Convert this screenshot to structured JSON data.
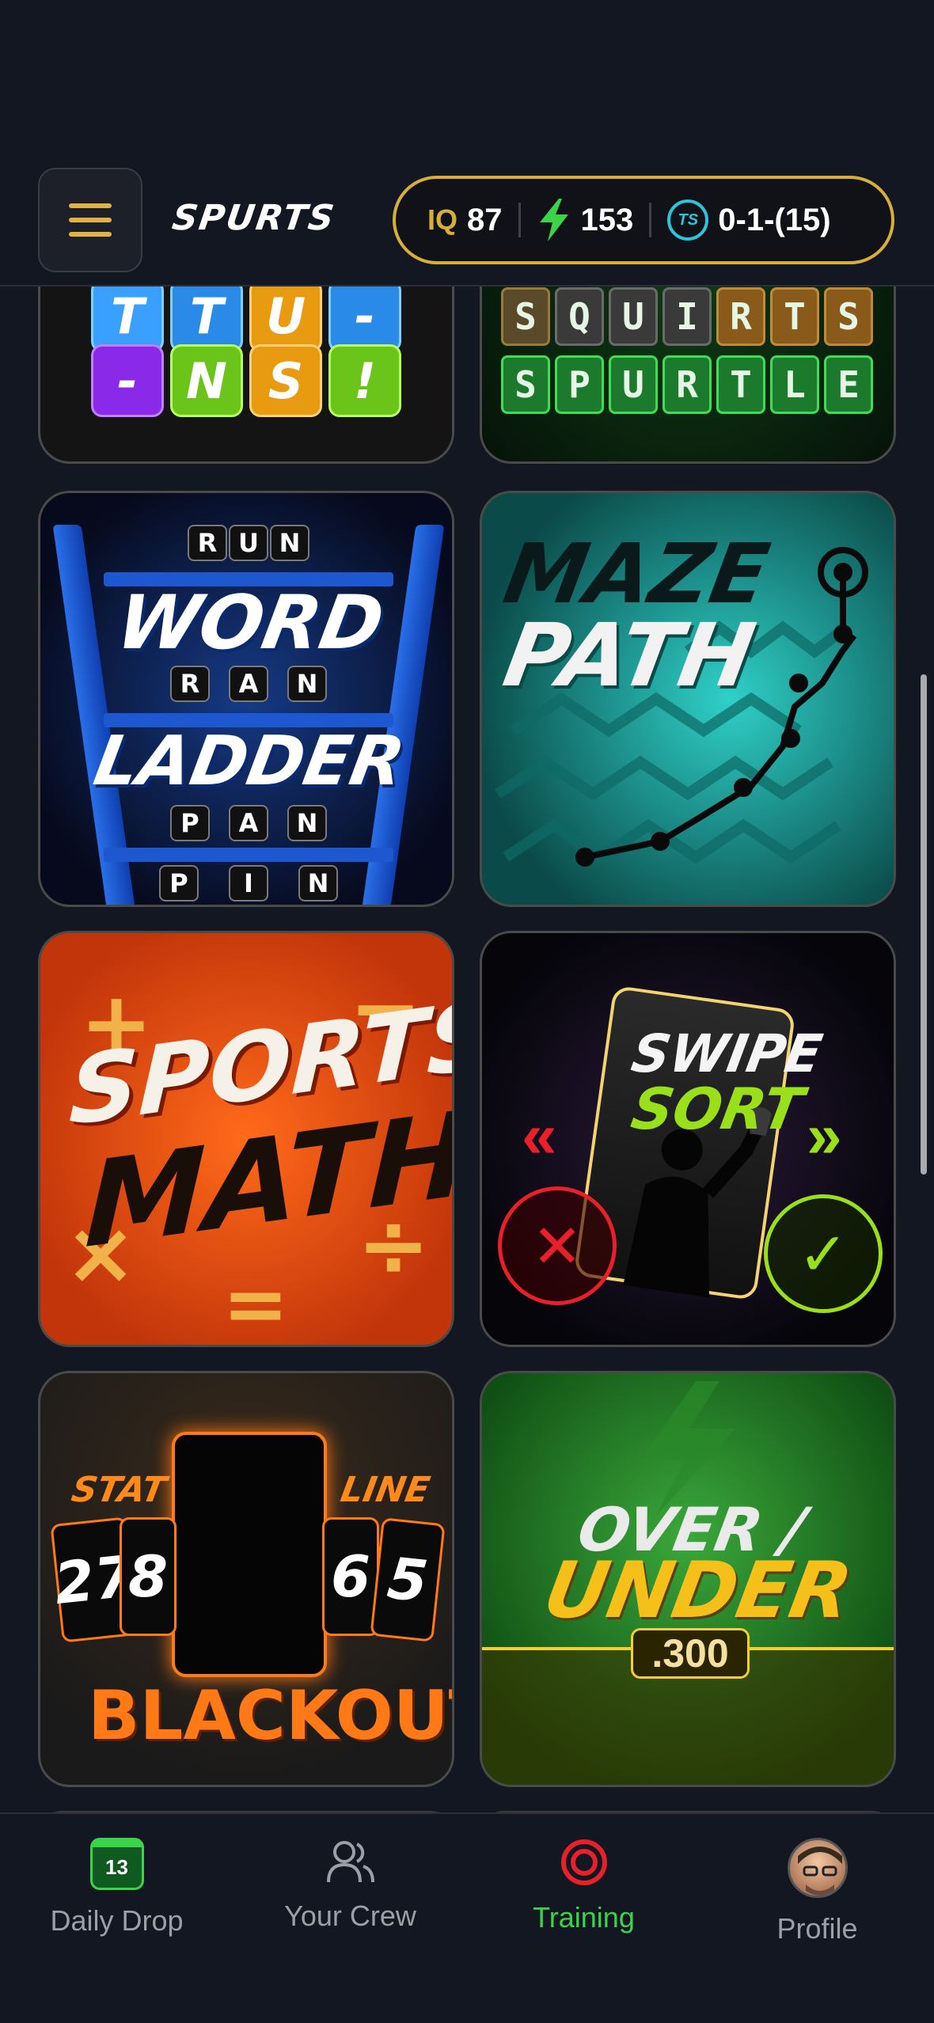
{
  "header": {
    "logo": "SPURTS",
    "stats": {
      "iq_label": "IQ",
      "iq_value": "87",
      "bolt_value": "153",
      "record_value": "0-1-(15)"
    }
  },
  "cards": [
    {
      "name": "card-ttuns",
      "tiles_row1": [
        "T",
        "T",
        "U",
        "-"
      ],
      "tiles_row2": [
        "-",
        "N",
        "S",
        "!"
      ]
    },
    {
      "name": "card-spurtle",
      "row1": [
        "S",
        "Q",
        "U",
        "I",
        "R",
        "T",
        "S"
      ],
      "row2": [
        "S",
        "P",
        "U",
        "R",
        "T",
        "L",
        "E"
      ]
    },
    {
      "name": "card-word-ladder",
      "title1": "WORD",
      "title2": "LADDER",
      "words": [
        "RUN",
        "RAN",
        "PAN",
        "PIN"
      ]
    },
    {
      "name": "card-maze-path",
      "title1": "MAZE",
      "title2": "PATH"
    },
    {
      "name": "card-sports-math",
      "title1": "SPORTS",
      "title2": "MATH",
      "symbols": [
        "+",
        "−",
        "×",
        "÷",
        "="
      ]
    },
    {
      "name": "card-swipe-sort",
      "title1": "SWIPE",
      "title2": "SORT"
    },
    {
      "name": "card-stat-line-blackout",
      "left_label": "STAT",
      "right_label": "LINE",
      "numbers": [
        "27",
        "8",
        "6",
        "5"
      ],
      "title": "BLACKOUT"
    },
    {
      "name": "card-over-under",
      "title1": "OVER /",
      "title2": "UNDER",
      "value": ".300"
    }
  ],
  "nav": {
    "items": [
      {
        "label": "Daily Drop",
        "badge": "13"
      },
      {
        "label": "Your Crew"
      },
      {
        "label": "Training"
      },
      {
        "label": "Profile"
      }
    ],
    "active": "Training"
  },
  "colors": {
    "accent_gold": "#d8ae3b",
    "active_green": "#3ad34a",
    "background": "#131722"
  }
}
